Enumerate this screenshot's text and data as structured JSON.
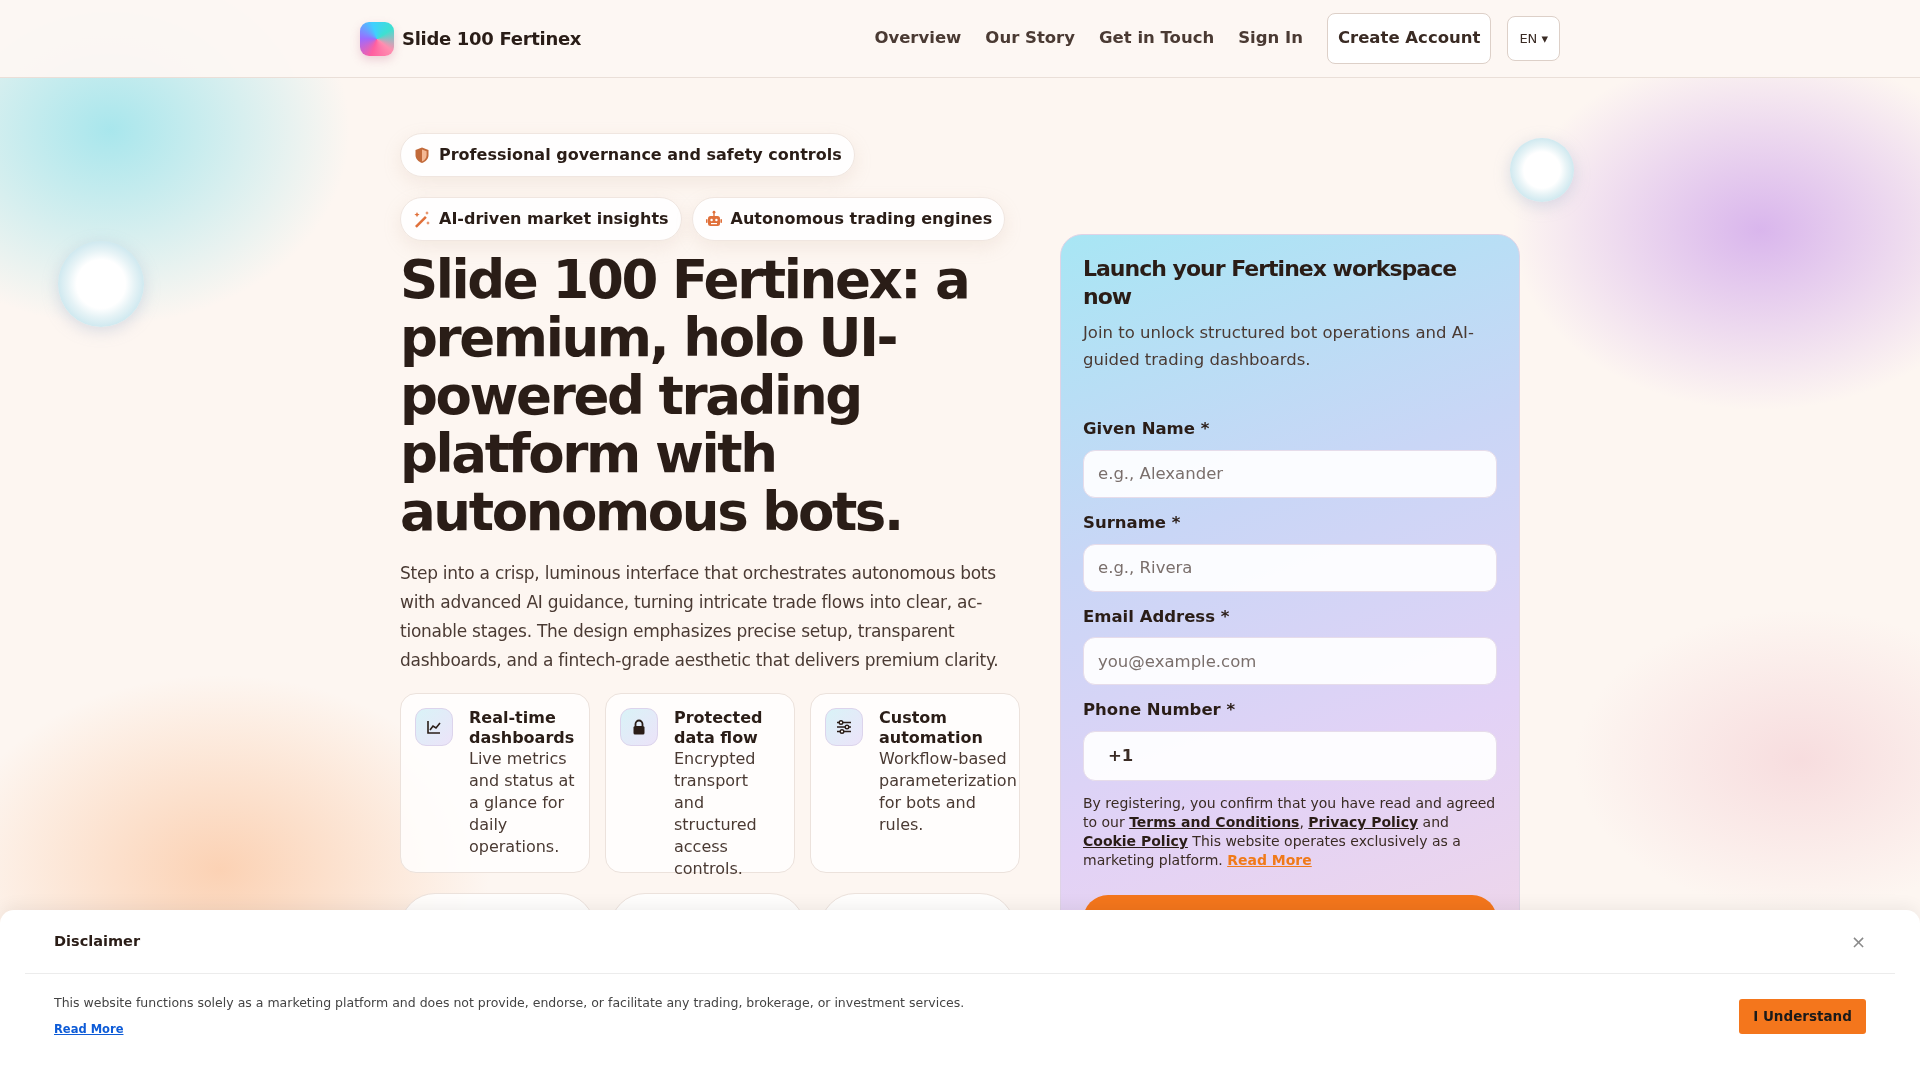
{
  "header": {
    "brand": "Slide 100 Fertinex",
    "nav": [
      "Overview",
      "Our Story",
      "Get in Touch",
      "Sign In"
    ],
    "cta": "Create Account",
    "language": "EN ▾"
  },
  "hero": {
    "badges": [
      {
        "label": "Professional governance and safety controls"
      },
      {
        "label": "AI-driven market insights"
      },
      {
        "label": "Autonomous trading engines"
      }
    ],
    "title": "Slide 100 Fertinex: a premium, holo UI-powered trading platform with autonomous bots.",
    "lead": "Step into a crisp, luminous interface that orchestrates autonomous bots with advanced AI guidance, turning intricate trade flows into clear, ac-tionable stages. The design emphasizes precise setup, transparent dashboards, and a fintech-grade aesthetic that delivers premium clarity.",
    "features": [
      {
        "title": "Real-time dashboards",
        "text": "Live metrics and status at a glance for daily operations."
      },
      {
        "title": "Protected data flow",
        "text": "Encrypted transport and structured access controls."
      },
      {
        "title": "Custom automation",
        "text": "Workflow-based parameterization for bots and rules."
      }
    ]
  },
  "form": {
    "title": "Launch your Fertinex workspace now",
    "subtitle": "Join to unlock structured bot operations and AI-guided trading dashboards.",
    "fields": [
      {
        "kind": "text",
        "label": "Given Name *",
        "placeholder": "e.g., Alexander"
      },
      {
        "kind": "text",
        "label": "Surname *",
        "placeholder": "e.g., Rivera"
      },
      {
        "kind": "email",
        "label": "Email Address *",
        "placeholder": "you@example.com"
      },
      {
        "kind": "phone",
        "label": "Phone Number *",
        "prefix": "+1"
      }
    ],
    "consent": [
      {
        "kind": "plain",
        "text": "By registering, you confirm that you have read and agreed to our "
      },
      {
        "kind": "link",
        "text": "Terms and Conditions"
      },
      {
        "kind": "plain",
        "text": ", "
      },
      {
        "kind": "link",
        "text": "Privacy Policy"
      },
      {
        "kind": "plain",
        "text": " and "
      },
      {
        "kind": "link",
        "text": "Cookie Policy"
      },
      {
        "kind": "plain",
        "text": " This website operates exclusively as a marketing platform. "
      },
      {
        "kind": "accent",
        "text": "Read More"
      }
    ]
  },
  "disclaimer": {
    "title": "Disclaimer",
    "close": "×",
    "text": "This website functions solely as a marketing platform and does not provide, endorse, or facilitate any trading, brokerage, or investment services.",
    "link": "Read More",
    "button": "I Understand"
  }
}
